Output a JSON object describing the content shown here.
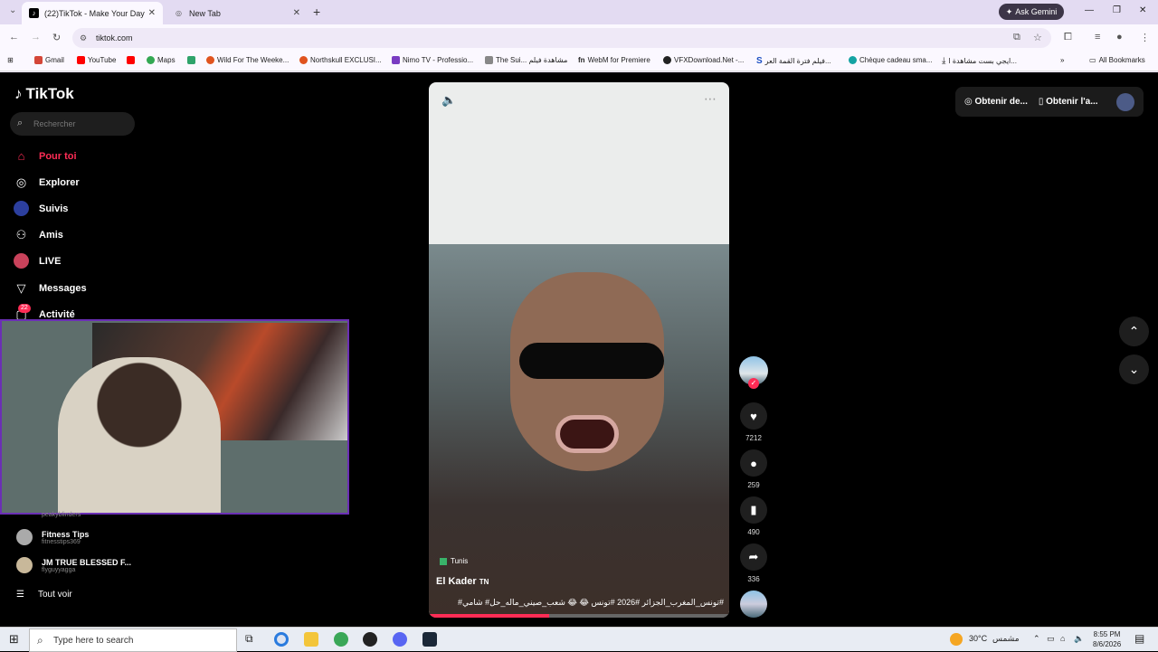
{
  "browser": {
    "tabs": [
      {
        "title": "(22)TikTok - Make Your Day",
        "active": true
      },
      {
        "title": "New Tab",
        "active": false
      }
    ],
    "new_tab_symbol": "+",
    "ask_gemini": "Ask Gemini",
    "url": "tiktok.com",
    "bookmarks": [
      {
        "label": "Gmail",
        "color": "#d44638"
      },
      {
        "label": "YouTube",
        "color": "#ff0000"
      },
      {
        "label": "",
        "color": "#ff0000"
      },
      {
        "label": "Maps",
        "color": "#34a853"
      },
      {
        "label": "",
        "color": "#2fa36b"
      },
      {
        "label": "Wild For The Weeke...",
        "color": "#e0531f"
      },
      {
        "label": "Northskull EXCLUSI...",
        "color": "#e0531f"
      },
      {
        "label": "Nimo TV - Professio...",
        "color": "#7a3cc2"
      },
      {
        "label": "The Sui... مشاهدة فيلم",
        "color": "#888888"
      },
      {
        "label": "WebM for Premiere",
        "color": "#333333"
      },
      {
        "label": "VFXDownload.Net -...",
        "color": "#222222"
      },
      {
        "label": "فيلم فترة القمة العر...",
        "color": "#1b4ec2"
      },
      {
        "label": "Chèque cadeau sma...",
        "color": "#15a3a3"
      },
      {
        "label": "ايجي بست مشاهدة ا...",
        "color": "#222222"
      }
    ],
    "all_bookmarks": "All Bookmarks"
  },
  "sidebar": {
    "logo": "TikTok",
    "search_placeholder": "Rechercher",
    "items": [
      {
        "label": "Pour toi",
        "icon": "home-icon"
      },
      {
        "label": "Explorer",
        "icon": "compass-icon"
      },
      {
        "label": "Suivis",
        "icon": "following-icon"
      },
      {
        "label": "Amis",
        "icon": "friends-icon"
      },
      {
        "label": "LIVE",
        "icon": "live-icon"
      },
      {
        "label": "Messages",
        "icon": "messages-icon"
      },
      {
        "label": "Activité",
        "icon": "activity-icon"
      }
    ],
    "activity_badge": "22",
    "following_accounts": [
      {
        "name": "",
        "handle": "peakyblinders"
      },
      {
        "name": "Fitness Tips",
        "handle": "fitnesstips369"
      },
      {
        "name": "JM TRUE BLESSED F...",
        "handle": "flyguyyagga"
      }
    ],
    "see_all": "Tout voir"
  },
  "video": {
    "location": "Tunis",
    "author": "El Kader",
    "author_flag": "TN",
    "caption": "#تونس_المغرب_الجزائر #2026 #تونس 😂 😂 شعب_صيني_ماله_حل# شامي#",
    "progress_percent": 40,
    "stats": {
      "likes": "7212",
      "comments": "259",
      "saves": "490",
      "shares": "336"
    }
  },
  "top_right": {
    "get_coins": "Obtenir de...",
    "get_app": "Obtenir l'a..."
  },
  "taskbar": {
    "search_placeholder": "Type here to search",
    "weather": "30°C",
    "weather_text": "مشمس",
    "time": "8:55 PM",
    "date": "8/6/2026"
  }
}
